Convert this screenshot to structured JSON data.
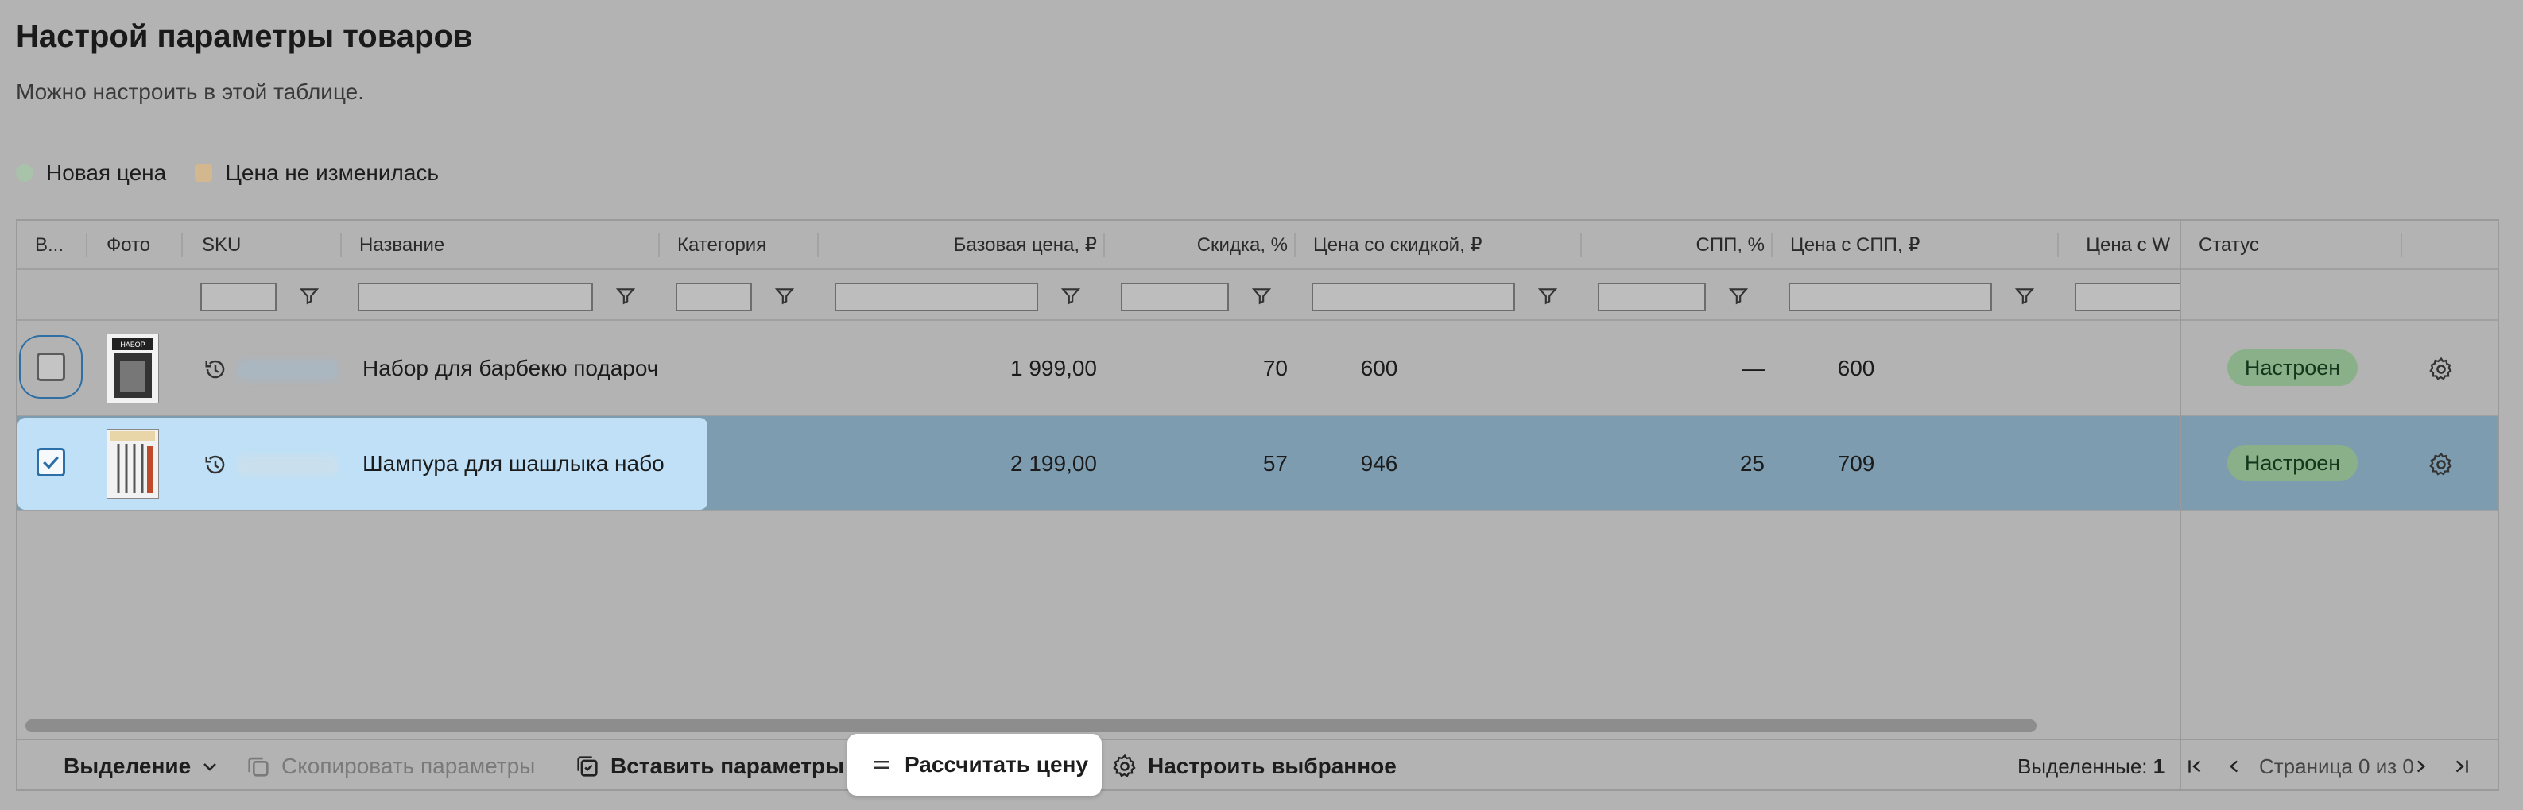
{
  "page": {
    "title": "Настрой параметры товаров",
    "subtitle": "Можно настроить в этой таблице."
  },
  "legend": {
    "items": [
      {
        "label": "Новая цена",
        "color": "#a9c3ab"
      },
      {
        "label": "Цена не изменилась",
        "color": "#d3b88f"
      }
    ]
  },
  "table": {
    "columns": {
      "select": "В...",
      "photo": "Фото",
      "sku": "SKU",
      "name": "Название",
      "category": "Категория",
      "base_price": "Базовая цена, ₽",
      "discount": "Скидка, %",
      "discount_price": "Цена со скидкой, ₽",
      "spp": "СПП, %",
      "spp_price": "Цена с СПП, ₽",
      "wallet_price": "Цена с W",
      "status": "Статус"
    },
    "rows": [
      {
        "selected": false,
        "name": "Набор для барбекю подароч",
        "base_price": "1 999,00",
        "discount": "70",
        "discount_price": "600",
        "spp": "—",
        "spp_price": "600",
        "status": "Настроен"
      },
      {
        "selected": true,
        "name": "Шампура для шашлыка набо",
        "base_price": "2 199,00",
        "discount": "57",
        "discount_price": "946",
        "spp": "25",
        "spp_price": "709",
        "status": "Настроен"
      }
    ]
  },
  "footer": {
    "selection_label": "Выделение",
    "copy_label": "Скопировать параметры",
    "paste_label": "Вставить параметры",
    "calc_label": "Рассчитать цену",
    "configure_label": "Настроить выбранное",
    "selected_prefix": "Выделенные:",
    "selected_count": "1",
    "page_info": "Страница 0 из 0"
  },
  "colors": {
    "background": "#b3b3b3",
    "selected_row": "#7e9caf",
    "status_badge": "#8ab08a",
    "highlight": "#bfe0f6"
  },
  "icons": [
    "history-icon",
    "filter-icon",
    "gear-icon",
    "chevron-down-icon",
    "copy-icon",
    "paste-icon",
    "equals-icon",
    "first-page-icon",
    "prev-page-icon",
    "next-page-icon",
    "last-page-icon",
    "checkmark-icon"
  ]
}
